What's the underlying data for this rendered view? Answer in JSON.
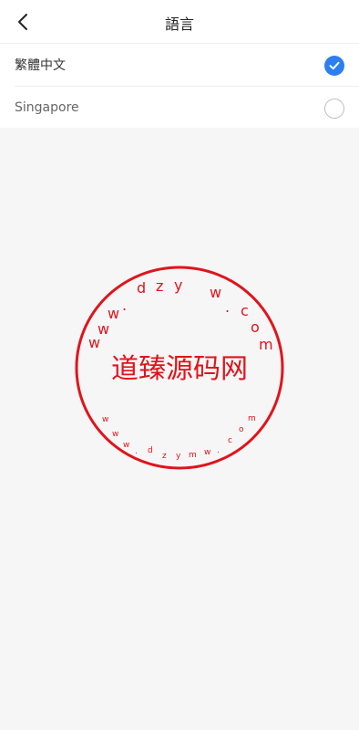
{
  "header": {
    "title": "語言",
    "back_icon": "chevron-left-icon"
  },
  "languages": [
    {
      "label": "繁體中文",
      "selected": true
    },
    {
      "label": "Singapore",
      "selected": false
    }
  ],
  "colors": {
    "accent": "#2b7ff0",
    "seal_red": "#e0141b",
    "background": "#f6f6f6"
  },
  "watermark": {
    "center_text": "道臻源码网",
    "ring_text": "www.dzymw.com"
  }
}
